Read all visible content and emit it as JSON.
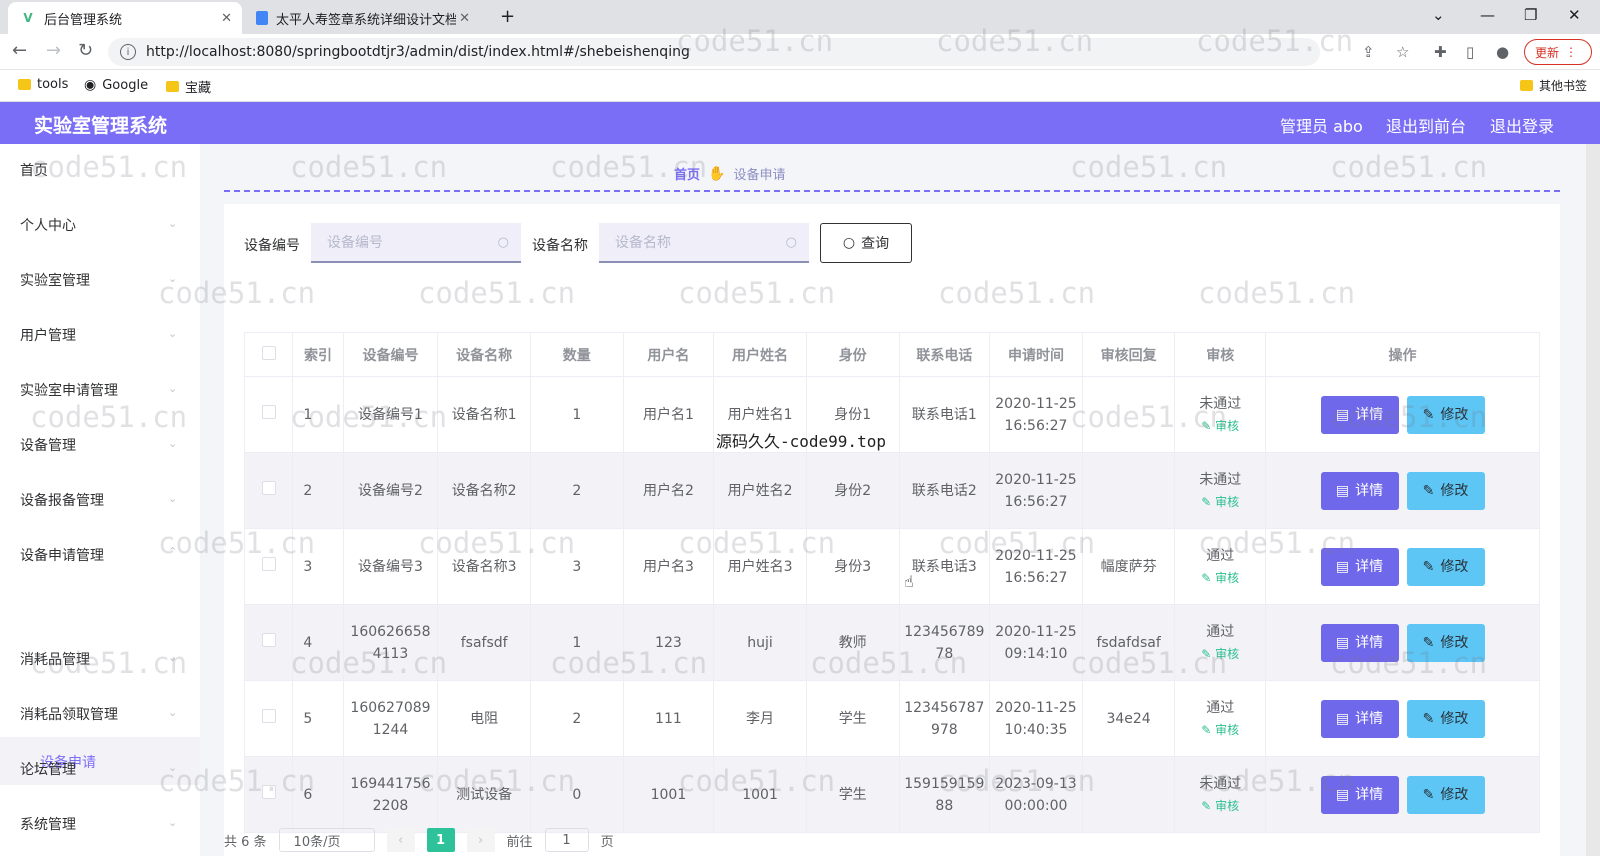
{
  "browser": {
    "tabs": [
      {
        "title": "后台管理系统",
        "favicon": "vue-icon",
        "active": true
      },
      {
        "title": "太平人寿签章系统详细设计文档",
        "favicon": "doc-icon",
        "active": false
      }
    ],
    "url": "http://localhost:8080/springbootdtjr3/admin/dist/index.html#/shebeishenqing",
    "update_label": "更新",
    "bookmarks": [
      {
        "label": "tools",
        "icon": "folder-icon"
      },
      {
        "label": "Google",
        "icon": "globe-icon"
      },
      {
        "label": "宝藏",
        "icon": "folder-icon"
      }
    ],
    "other_bookmarks": "其他书签"
  },
  "app": {
    "title": "实验室管理系统",
    "user": "管理员 abo",
    "to_front": "退出到前台",
    "logout": "退出登录"
  },
  "sidebar": {
    "items": [
      {
        "label": "首页",
        "chevron": false
      },
      {
        "label": "个人中心",
        "chevron": true
      },
      {
        "label": "实验室管理",
        "chevron": true
      },
      {
        "label": "用户管理",
        "chevron": true
      },
      {
        "label": "实验室申请管理",
        "chevron": true
      },
      {
        "label": "设备管理",
        "chevron": true
      },
      {
        "label": "设备报备管理",
        "chevron": true
      },
      {
        "label": "设备申请管理",
        "chevron": true,
        "expanded": true
      },
      {
        "label": "消耗品管理",
        "chevron": true
      },
      {
        "label": "消耗品领取管理",
        "chevron": true
      },
      {
        "label": "论坛管理",
        "chevron": true
      },
      {
        "label": "系统管理",
        "chevron": true
      }
    ],
    "active_sub": "设备申请"
  },
  "breadcrumb": {
    "home": "首页",
    "current": "设备申请"
  },
  "search": {
    "field1_label": "设备编号",
    "field1_placeholder": "设备编号",
    "field2_label": "设备名称",
    "field2_placeholder": "设备名称",
    "query_label": "查询"
  },
  "table": {
    "headers": [
      "",
      "索引",
      "设备编号",
      "设备名称",
      "数量",
      "用户名",
      "用户姓名",
      "身份",
      "联系电话",
      "申请时间",
      "审核回复",
      "审核",
      "操作"
    ],
    "rows": [
      {
        "idx": "1",
        "code": "设备编号1",
        "name": "设备名称1",
        "qty": "1",
        "user": "用户名1",
        "uname": "用户姓名1",
        "role": "身份1",
        "phone": "联系电话1",
        "time": "2020-11-25 16:56:27",
        "reply": "",
        "status": "未通过"
      },
      {
        "idx": "2",
        "code": "设备编号2",
        "name": "设备名称2",
        "qty": "2",
        "user": "用户名2",
        "uname": "用户姓名2",
        "role": "身份2",
        "phone": "联系电话2",
        "time": "2020-11-25 16:56:27",
        "reply": "",
        "status": "未通过"
      },
      {
        "idx": "3",
        "code": "设备编号3",
        "name": "设备名称3",
        "qty": "3",
        "user": "用户名3",
        "uname": "用户姓名3",
        "role": "身份3",
        "phone": "联系电话3",
        "time": "2020-11-25 16:56:27",
        "reply": "幅度萨芬",
        "status": "通过"
      },
      {
        "idx": "4",
        "code": "1606266584113",
        "name": "fsafsdf",
        "qty": "1",
        "user": "123",
        "uname": "huji",
        "role": "教师",
        "phone": "12345678978",
        "time": "2020-11-25 09:14:10",
        "reply": "fsdafdsaf",
        "status": "通过"
      },
      {
        "idx": "5",
        "code": "1606270891244",
        "name": "电阻",
        "qty": "2",
        "user": "111",
        "uname": "李月",
        "role": "学生",
        "phone": "123456787978",
        "time": "2020-11-25 10:40:35",
        "reply": "34e24",
        "status": "通过"
      },
      {
        "idx": "6",
        "code": "1694417562208",
        "name": "测试设备",
        "qty": "0",
        "user": "1001",
        "uname": "1001",
        "role": "学生",
        "phone": "15915915988",
        "time": "2023-09-13 00:00:00",
        "reply": "",
        "status": "未通过"
      }
    ],
    "audit_label": "审核",
    "detail_label": "详情",
    "edit_label": "修改"
  },
  "pagination": {
    "total": "共 6 条",
    "page_size": "10条/页",
    "current": "1",
    "goto_prefix": "前往",
    "goto_value": "1",
    "goto_suffix": "页"
  },
  "watermarks": {
    "site": "code51.cn",
    "center": "源码久久-code99.top"
  },
  "colors": {
    "accent": "#7b6ef6",
    "detail_btn": "#7068ea",
    "edit_btn": "#5dc6f5",
    "audit": "#2cbf8e"
  }
}
